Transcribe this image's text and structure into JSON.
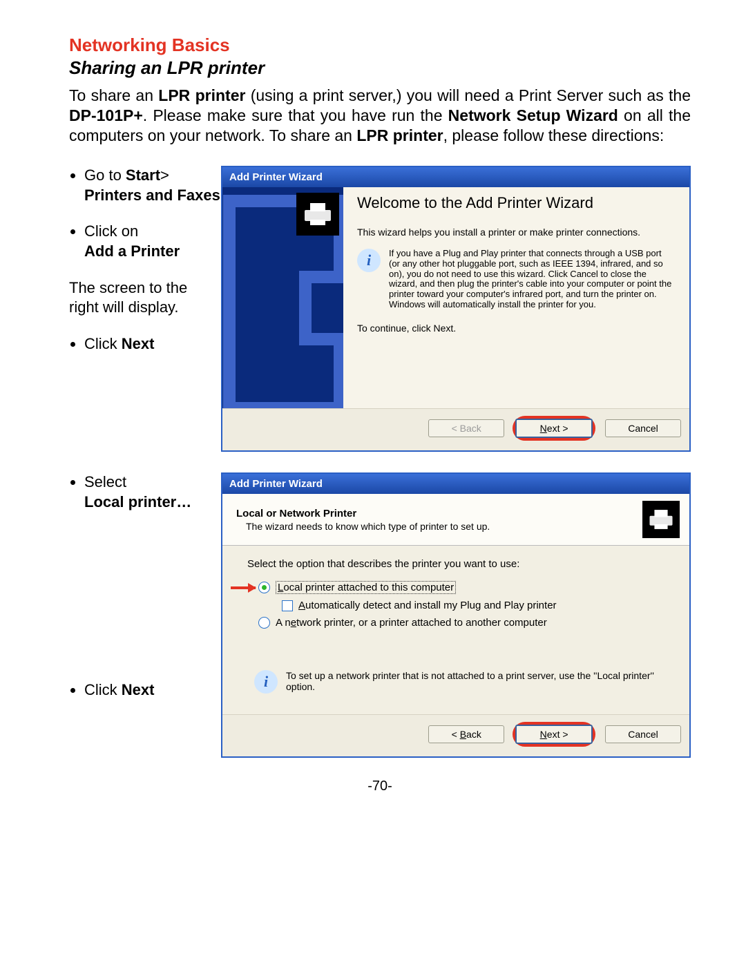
{
  "page_number": "-70-",
  "section_title": "Networking Basics",
  "subsection_title": "Sharing an LPR printer",
  "intro": {
    "p1a": "To share an ",
    "p1b": "LPR printer",
    "p1c": " (using a print server,) you will need a Print Server such as the ",
    "p1d": "DP-101P+",
    "p1e": ".   Please make sure that you have run the ",
    "p1f": "Network Setup Wizard",
    "p1g": " on all the computers on your network. To share an ",
    "p1h": "LPR printer",
    "p1i": ", please follow these directions:"
  },
  "steps1": {
    "s1a": "Go to ",
    "s1b": "Start",
    "s1c": "> ",
    "s1d": "Printers and Faxes",
    "s2a": "Click on ",
    "s2b": "Add a Printer",
    "note": "The screen to the right will display.",
    "s3a": "Click ",
    "s3b": "Next"
  },
  "steps2": {
    "s1a": "Select",
    "s1b": "Local printer…",
    "s2a": "Click ",
    "s2b": "Next"
  },
  "wizard_title": "Add Printer Wizard",
  "wizard1": {
    "heading": "Welcome to the Add Printer Wizard",
    "subtext": "This wizard helps you install a printer or make printer connections.",
    "pnp": "If you have a Plug and Play printer that connects through a USB port (or any other hot pluggable port, such as IEEE 1394, infrared, and so on), you do not need to use this wizard. Click Cancel to close the wizard, and then plug the printer's cable into your computer or point the printer toward your computer's infrared port, and turn the printer on. Windows will automatically install the printer for you.",
    "continue": "To continue, click Next.",
    "back": "< Back",
    "next_pre": "N",
    "next_rest": "ext >",
    "cancel": "Cancel"
  },
  "wizard2": {
    "title": "Local or Network Printer",
    "sub": "The wizard needs to know which type of printer to set up.",
    "prompt": "Select the option that describes the printer you want to use:",
    "opt1_pre": "L",
    "opt1_rest": "ocal printer attached to this computer",
    "opt2_pre": "A",
    "opt2_rest": "utomatically detect and install my Plug and Play printer",
    "opt3a": "A n",
    "opt3_pre": "e",
    "opt3_rest": "twork printer, or a printer attached to another computer",
    "hint": "To set up a network printer that is not attached to a print server, use the ''Local printer'' option.",
    "back_pre": "< ",
    "back_u": "B",
    "back_rest": "ack",
    "next_pre": "N",
    "next_rest": "ext >",
    "cancel": "Cancel"
  }
}
